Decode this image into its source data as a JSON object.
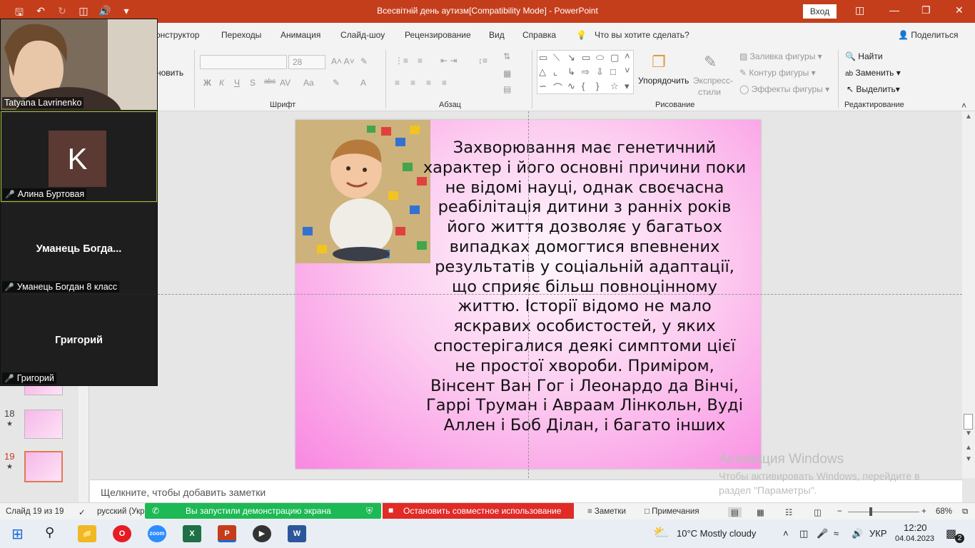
{
  "app": {
    "title": "Всесвітній день аутизм[Compatibility Mode]  -  PowerPoint",
    "signin": "Вход",
    "colors": {
      "accent": "#c43e1c",
      "slide_pink": "#f987e1",
      "zoom_bg": "#242424",
      "green": "#1db954",
      "red": "#e02b27"
    }
  },
  "tabs": {
    "items": [
      "онструктор",
      "Переходы",
      "Анимация",
      "Слайд-шоу",
      "Рецензирование",
      "Вид",
      "Справка"
    ],
    "search": "Что вы хотите сделать?",
    "share": "Поделиться"
  },
  "ribbon": {
    "font_size": "28",
    "groups": {
      "font": "Шрифт",
      "paragraph": "Абзац",
      "drawing": "Рисование",
      "editing": "Редактирование"
    },
    "clipboard_fragment": "новить",
    "arrange": "Упорядочить",
    "quick_styles_1": "Экспресс-",
    "quick_styles_2": "стили",
    "shape_fill": "Заливка фигуры",
    "shape_outline": "Контур фигуры",
    "shape_effects": "Эффекты фигуры",
    "find": "Найти",
    "replace": "Заменить",
    "select": "Выделить"
  },
  "zoom": {
    "participants": [
      {
        "label": "Tatyana Lavrinenko",
        "type": "video"
      },
      {
        "label": "Алина Буртовая",
        "initial": "K",
        "type": "avatar"
      },
      {
        "display": "Уманець  Богда...",
        "label": "Уманець Богдан 8 класс",
        "type": "name"
      },
      {
        "display": "Григорий",
        "label": "Григорий",
        "type": "name"
      }
    ]
  },
  "slides": {
    "items": [
      {
        "num": "18"
      },
      {
        "num": "19"
      }
    ]
  },
  "slide": {
    "text": "Захворювання має генетичний характер і його основні причини поки не відомі науці, однак своєчасна реабілітація дитини з ранніх років його життя дозволяє у багатьох випадках домогтися впевнених результатів у соціальній адаптації, що сприяє більш повноцінному життю. Історії відомо не мало яскравих особистостей, у яких спостерігалися деякі симптоми цієї не простої хвороби. Приміром, Вінсент Ван Гог і Леонардо да Вінчі, Гаррі Труман і Авраам Лінкольн, Вуді Аллен і Боб Ділан, і багато інших"
  },
  "notes": {
    "placeholder": "Щелкните, чтобы добавить заметки"
  },
  "watermark": {
    "title": "Активация Windows",
    "line": "Чтобы активировать Windows, перейдите в раздел \"Параметры\"."
  },
  "statusbar": {
    "slide_counter": "Слайд 19 из 19",
    "language": "русский (Укр",
    "sharing": "Вы запустили демонстрацию экрана",
    "stop_sharing": "Остановить совместное использование",
    "notes": "Заметки",
    "comments": "Примечания",
    "zoom": "68%"
  },
  "taskbar": {
    "weather": "10°C  Mostly cloudy",
    "lang": "УКР",
    "time": "12:20",
    "date": "04.04.2023",
    "notifications": "2",
    "apps": [
      "file-explorer",
      "opera",
      "zoom",
      "excel",
      "powerpoint",
      "media-player",
      "word"
    ]
  }
}
